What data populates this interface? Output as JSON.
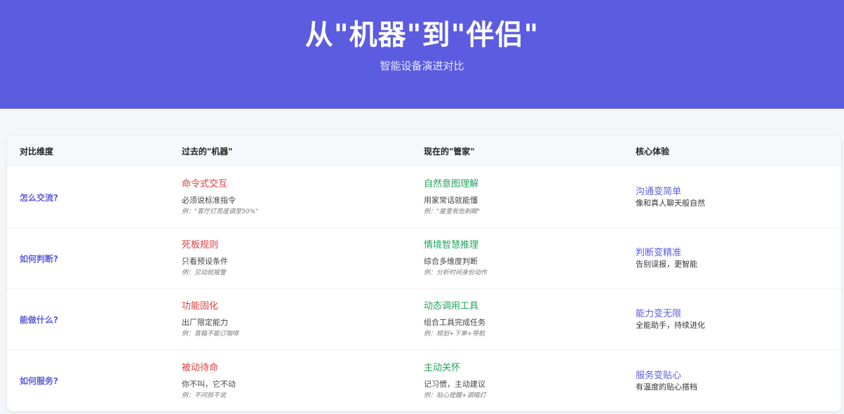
{
  "hero": {
    "title": "从\"机器\"到\"伴侣\"",
    "subtitle": "智能设备演进对比"
  },
  "table": {
    "headers": {
      "dimension": "对比维度",
      "past": "过去的\"机器\"",
      "now": "现在的\"管家\"",
      "experience": "核心体验"
    },
    "rows": [
      {
        "dimension": "怎么交流?",
        "past_title": "命令式交互",
        "past_desc": "必须说标准指令",
        "past_example": "例：\"客厅灯亮度调至50%\"",
        "now_title": "自然意图理解",
        "now_desc": "用家常话就能懂",
        "now_example": "例：\"屋里有些刺眼\"",
        "exp_title": "沟通变简单",
        "exp_desc": "像和真人聊天般自然"
      },
      {
        "dimension": "如何判断?",
        "past_title": "死板规则",
        "past_desc": "只看预设条件",
        "past_example": "例：见动就报警",
        "now_title": "情境智慧推理",
        "now_desc": "综合多维度判断",
        "now_example": "例：分析时间身份动作",
        "exp_title": "判断变精准",
        "exp_desc": "告别误报，更智能"
      },
      {
        "dimension": "能做什么?",
        "past_title": "功能固化",
        "past_desc": "出厂限定能力",
        "past_example": "例：音箱不能订咖啡",
        "now_title": "动态调用工具",
        "now_desc": "组合工具完成任务",
        "now_example": "例：规划+下单+导航",
        "exp_title": "能力变无限",
        "exp_desc": "全能助手，持续进化"
      },
      {
        "dimension": "如何服务?",
        "past_title": "被动待命",
        "past_desc": "你不叫，它不动",
        "past_example": "例：不问就不说",
        "now_title": "主动关怀",
        "now_desc": "记习惯，主动建议",
        "now_example": "例：贴心提醒+调暗灯",
        "exp_title": "服务变贴心",
        "exp_desc": "有温度的贴心搭档"
      }
    ]
  },
  "colors": {
    "brand": "#5c5ce0",
    "past": "#e03a3a",
    "now": "#22a45b"
  }
}
